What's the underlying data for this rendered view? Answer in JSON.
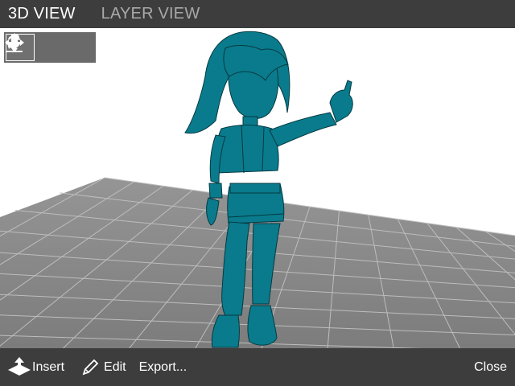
{
  "tabs": [
    {
      "label": "3D VIEW",
      "active": true
    },
    {
      "label": "LAYER VIEW",
      "active": false
    }
  ],
  "toolbar": {
    "tools": [
      {
        "icon": "rotate-icon",
        "selected": true
      },
      {
        "icon": "move-icon",
        "selected": false
      },
      {
        "icon": "lay-flat-icon",
        "selected": false
      }
    ]
  },
  "bottom_bar": {
    "insert_label": "Insert",
    "edit_label": "Edit",
    "export_label": "Export...",
    "close_label": "Close"
  },
  "colors": {
    "bar_background": "#3d3d3d",
    "model": "#0a7b8c",
    "build_plate": "#8a8a8a",
    "viewport_background": "#ffffff"
  }
}
